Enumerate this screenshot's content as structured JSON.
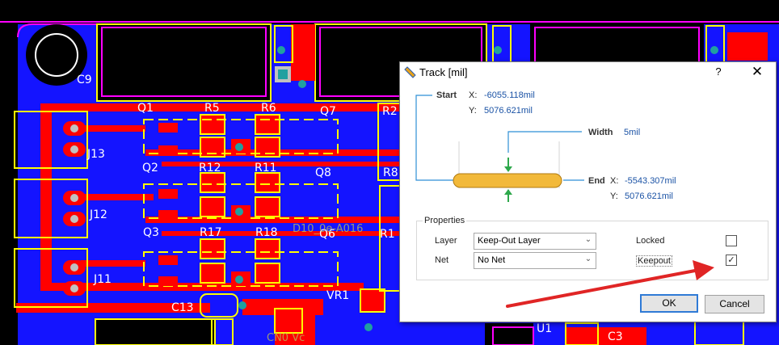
{
  "pcb": {
    "component_labels": [
      "C9",
      "Q1",
      "R5",
      "R6",
      "Q7",
      "R2",
      "J13",
      "Q2",
      "R12",
      "R11",
      "Q8",
      "R8",
      "J12",
      "Q3",
      "R17",
      "R18",
      "Q6",
      "R1",
      "J11",
      "C13",
      "VR1",
      "U1",
      "C3"
    ],
    "faint_text": "D10_0e-A016",
    "faint_text_2": "CN0 Vc"
  },
  "dialog": {
    "title": "Track [mil]",
    "help": "?",
    "close": "✕",
    "start_label": "Start",
    "start_x_label": "X:",
    "start_x": "-6055.118mil",
    "start_y_label": "Y:",
    "start_y": "5076.621mil",
    "width_label": "Width",
    "width_value": "5mil",
    "end_label": "End",
    "end_x_label": "X:",
    "end_x": "-5543.307mil",
    "end_y_label": "Y:",
    "end_y": "5076.621mil",
    "properties_title": "Properties",
    "layer_label": "Layer",
    "layer_value": "Keep-Out Layer",
    "net_label": "Net",
    "net_value": "No Net",
    "locked_label": "Locked",
    "locked_checked": false,
    "keepout_label": "Keepout",
    "keepout_checked": true,
    "ok_label": "OK",
    "cancel_label": "Cancel"
  },
  "colors": {
    "board_blue": "#1414ff",
    "copper_red": "#ff0000",
    "silkscreen_yellow": "#ffff00",
    "keepout_magenta": "#ff00ff",
    "annotation_arrow": "#e02525",
    "value_blue": "#1a52a5"
  }
}
